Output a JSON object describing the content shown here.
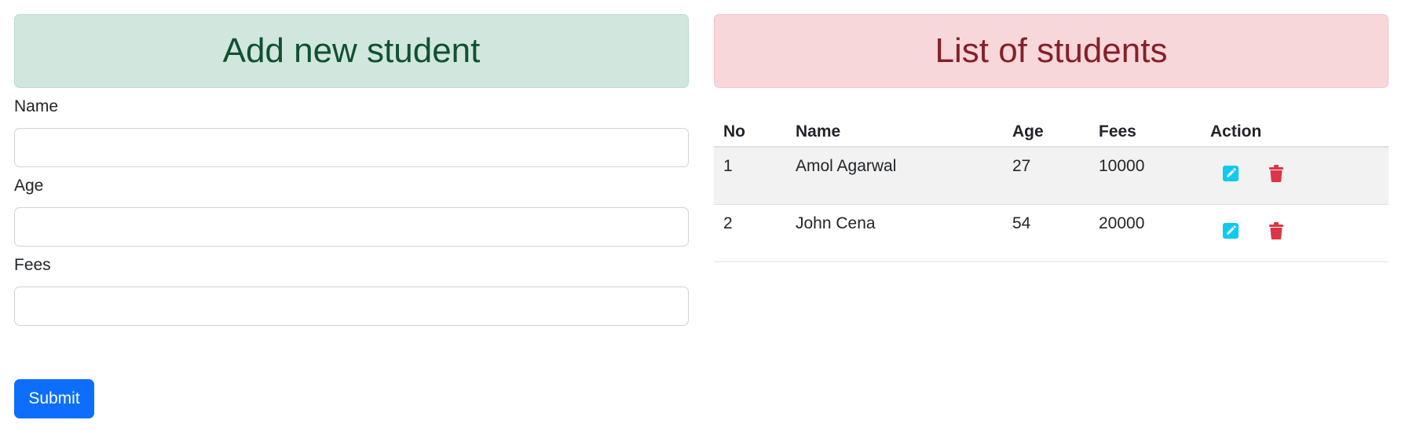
{
  "add_panel": {
    "title": "Add new student",
    "fields": [
      {
        "label": "Name",
        "value": "",
        "placeholder": ""
      },
      {
        "label": "Age",
        "value": "",
        "placeholder": ""
      },
      {
        "label": "Fees",
        "value": "",
        "placeholder": ""
      }
    ],
    "submit_label": "Submit"
  },
  "list_panel": {
    "title": "List of students",
    "columns": [
      "No",
      "Name",
      "Age",
      "Fees",
      "Action"
    ],
    "rows": [
      {
        "no": "1",
        "name": "Amol Agarwal",
        "age": "27",
        "fees": "10000"
      },
      {
        "no": "2",
        "name": "John Cena",
        "age": "54",
        "fees": "20000"
      }
    ],
    "row_icons": [
      "edit-icon",
      "trash-icon"
    ]
  },
  "colors": {
    "primary": "#0d6efd",
    "success_bg": "#d1e7dd",
    "success_text": "#0f5132",
    "danger_bg": "#f8d7da",
    "danger_text": "#842029",
    "edit_icon": "#0dcaf0",
    "delete_icon": "#dc3545"
  }
}
